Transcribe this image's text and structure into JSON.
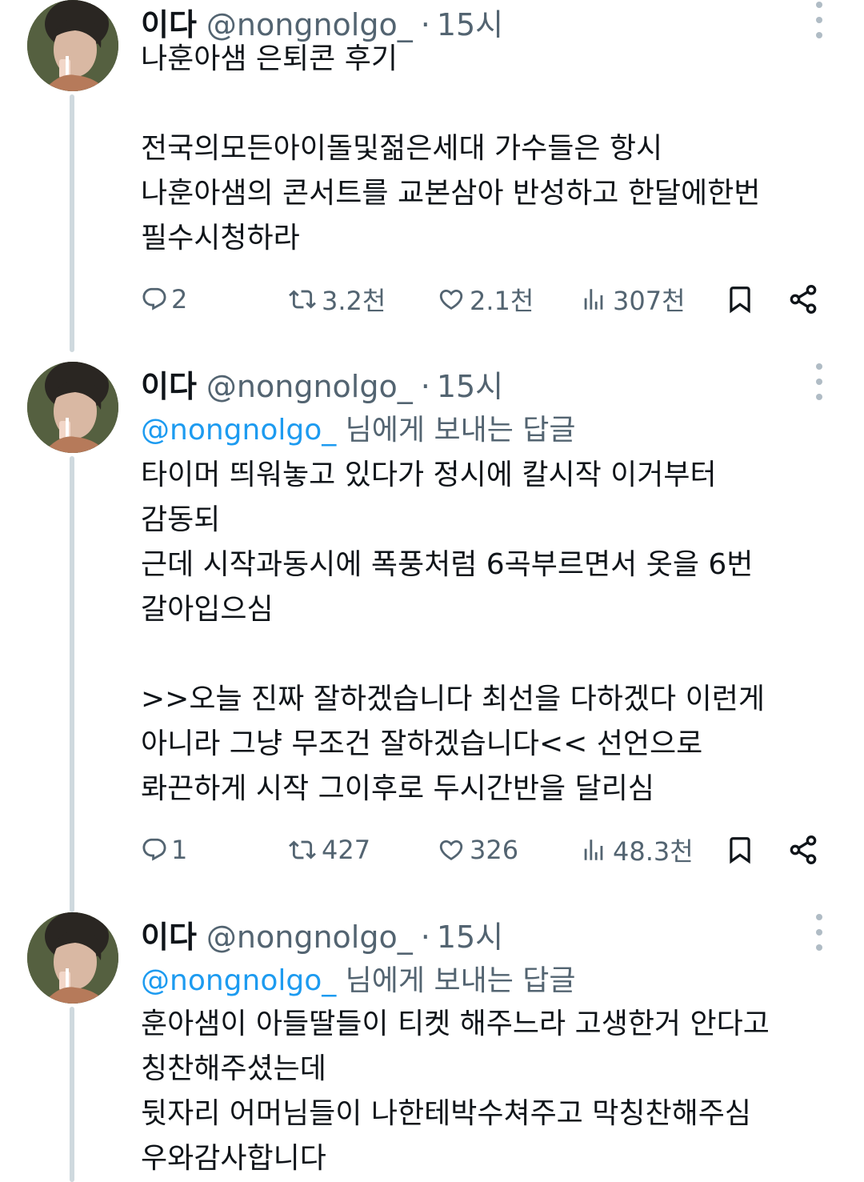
{
  "tweets": [
    {
      "name": "이다",
      "handle": "@nongnolgo_",
      "dot": "·",
      "time": "15시",
      "replying": null,
      "lines": [
        "나훈아샘 은퇴콘 후기",
        "",
        "전국의모든아이돌및젊은세대 가수들은 항시",
        "나훈아샘의 콘서트를 교본삼아 반성하고 한달에한번",
        "필수시청하라"
      ],
      "replies": "2",
      "retweets": "3.2천",
      "likes": "2.1천",
      "views": "307천"
    },
    {
      "name": "이다",
      "handle": "@nongnolgo_",
      "dot": "·",
      "time": "15시",
      "replying": {
        "mention": "@nongnolgo_",
        "suffix": " 님에게 보내는 답글"
      },
      "lines": [
        "타이머 띄워놓고 있다가 정시에 칼시작 이거부터",
        "감동되",
        "근데 시작과동시에 폭풍처럼 6곡부르면서 옷을 6번",
        "갈아입으심",
        "",
        ">>오늘 진짜 잘하겠습니다 최선을 다하겠다 이런게",
        "아니라 그냥 무조건 잘하겠습니다<< 선언으로",
        "롸끈하게 시작 그이후로 두시간반을 달리심"
      ],
      "replies": "1",
      "retweets": "427",
      "likes": "326",
      "views": "48.3천"
    },
    {
      "name": "이다",
      "handle": "@nongnolgo_",
      "dot": "·",
      "time": "15시",
      "replying": {
        "mention": "@nongnolgo_",
        "suffix": " 님에게 보내는 답글"
      },
      "lines": [
        "훈아샘이 아들딸들이 티켓 해주느라 고생한거 안다고",
        "칭찬해주셨는데",
        "뒷자리 어머님들이 나한테박수쳐주고 막칭찬해주심",
        "우와감사합니다"
      ]
    }
  ],
  "icons": {
    "reply": "reply-icon",
    "retweet": "retweet-icon",
    "like": "heart-icon",
    "views": "views-icon",
    "bookmark": "bookmark-icon",
    "share": "share-icon",
    "more": "more-vertical-icon"
  },
  "colors": {
    "text": "#0f1419",
    "muted": "#536471",
    "link": "#1d9bf0",
    "thread_line": "#cfd9de"
  }
}
